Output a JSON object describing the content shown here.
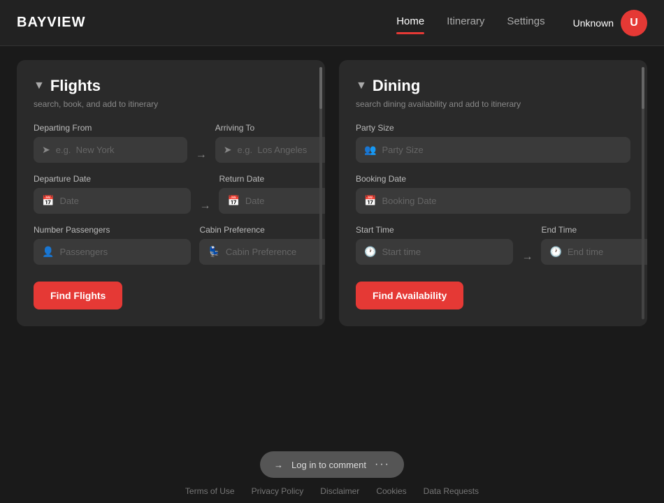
{
  "brand": "BAYVIEW",
  "nav": {
    "links": [
      {
        "label": "Home",
        "active": true
      },
      {
        "label": "Itinerary",
        "active": false
      },
      {
        "label": "Settings",
        "active": false
      }
    ],
    "user_name": "Unknown",
    "user_initial": "U"
  },
  "flights": {
    "title": "Flights",
    "subtitle": "search, book, and add to itinerary",
    "departing_from_label": "Departing From",
    "departing_placeholder": "e.g.  New York",
    "arriving_to_label": "Arriving To",
    "arriving_placeholder": "e.g.  Los Angeles",
    "departure_date_label": "Departure Date",
    "departure_date_placeholder": "Date",
    "return_date_label": "Return Date",
    "return_date_placeholder": "Date",
    "number_passengers_label": "Number Passengers",
    "passengers_placeholder": "Passengers",
    "cabin_preference_label": "Cabin Preference",
    "cabin_placeholder": "Cabin Preference",
    "find_btn": "Find Flights"
  },
  "dining": {
    "title": "Dining",
    "subtitle": "search dining availability and add to itinerary",
    "party_size_label": "Party Size",
    "party_size_placeholder": "Party Size",
    "booking_date_label": "Booking Date",
    "booking_date_placeholder": "Booking Date",
    "start_time_label": "Start Time",
    "start_time_placeholder": "Start time",
    "end_time_label": "End Time",
    "end_time_placeholder": "End time",
    "find_btn": "Find Availability"
  },
  "footer_bar": {
    "icon": "→",
    "label": "Log in to comment",
    "dots": "···"
  },
  "footer_links": [
    "Terms of Use",
    "Privacy Policy",
    "Disclaimer",
    "Cookies",
    "Data Requests"
  ]
}
